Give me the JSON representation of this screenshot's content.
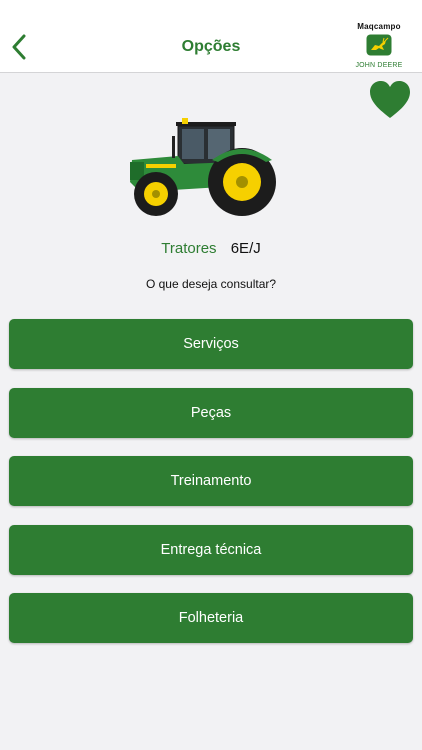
{
  "header": {
    "title": "Opções",
    "back_icon": "chevron-left-icon",
    "brand_name": "Maqcampo",
    "brand_sub": "JOHN DEERE",
    "accent": "#2e7d32"
  },
  "favorite": {
    "icon": "heart-icon",
    "color": "#2e7d32"
  },
  "product": {
    "image": "tractor-image",
    "category": "Tratores",
    "model": "6E/J"
  },
  "question": "O que deseja consultar?",
  "menu": [
    {
      "label": "Serviços"
    },
    {
      "label": "Peças"
    },
    {
      "label": "Treinamento"
    },
    {
      "label": "Entrega técnica"
    },
    {
      "label": "Folheteria"
    }
  ]
}
